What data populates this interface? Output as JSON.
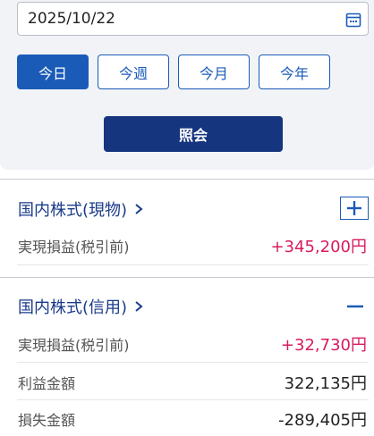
{
  "filter": {
    "date_value": "2025/10/22",
    "ranges": [
      "今日",
      "今週",
      "今月",
      "今年"
    ],
    "active_range": "今日",
    "query_label": "照会"
  },
  "sections": [
    {
      "title": "国内株式(現物)",
      "toggle": "expand",
      "rows": [
        {
          "label": "実現損益(税引前)",
          "value": "+345,200円",
          "color": "#d81b60"
        }
      ]
    },
    {
      "title": "国内株式(信用)",
      "toggle": "collapse",
      "rows": [
        {
          "label": "実現損益(税引前)",
          "value": "+32,730円",
          "color": "#d81b60"
        },
        {
          "label": "利益金額",
          "value": "322,135円"
        },
        {
          "label": "損失金額",
          "value": "-289,405円"
        }
      ]
    }
  ],
  "colors": {
    "accent": "#1a5bb8",
    "primary_dark": "#16357f",
    "gain": "#d81b60",
    "title": "#1a3b8a"
  }
}
